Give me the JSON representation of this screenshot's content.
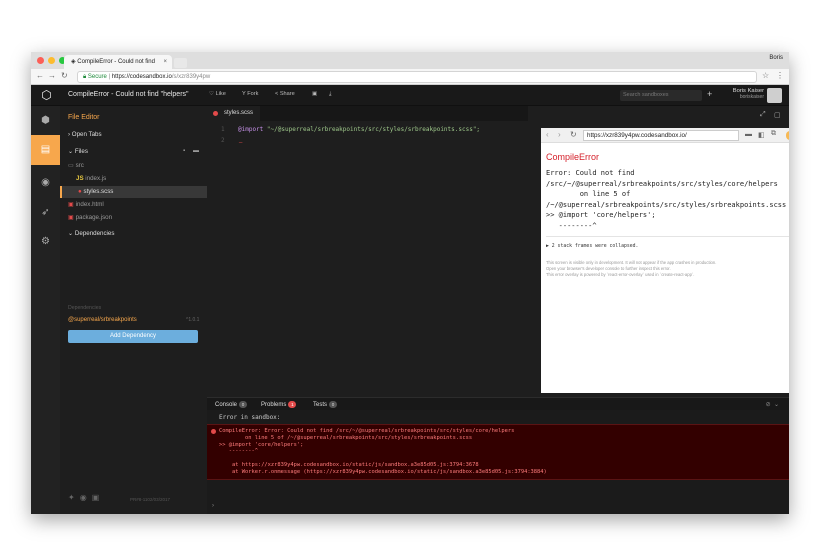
{
  "browser": {
    "tab_title": "CompileError - Could not find",
    "tab_close": "×",
    "profile_name": "Boris",
    "secure_label": "Secure",
    "url_host": "https://codesandbox.io",
    "url_path": "/s/xzr839y4pw"
  },
  "header": {
    "title": "CompileError - Could not find \"helpers\"",
    "like": "Like",
    "fork": "Fork",
    "share": "Share",
    "search_placeholder": "Search sandboxes",
    "user_name": "Boris Kaiser",
    "user_handle": "boriskaiser"
  },
  "explorer": {
    "title": "File Editor",
    "open_tabs": "Open Tabs",
    "files": "Files",
    "items": [
      {
        "name": "src",
        "icon": "folder-icon"
      },
      {
        "name": "index.js",
        "icon": "js-file-icon"
      },
      {
        "name": "styles.scss",
        "icon": "error-dot-icon"
      },
      {
        "name": "index.html",
        "icon": "html-file-icon"
      },
      {
        "name": "package.json",
        "icon": "json-file-icon"
      }
    ],
    "dependencies": "Dependencies",
    "dependencies_sub": "Dependencies",
    "dep_name": "@superreal/srbreakpoints",
    "dep_version": "^1.0.1",
    "add_dependency": "Add Dependency",
    "version_text": "PR#8-1102/03/2017"
  },
  "editor": {
    "tab": "styles.scss",
    "line_numbers": [
      "1",
      "2"
    ],
    "code_keyword": "@import",
    "code_string": "\"~/@superreal/srbreakpoints/src/styles/srbreakpoints.scss\";",
    "error_marker": "_"
  },
  "preview": {
    "url": "https://xzr839y4pw.codesandbox.io/",
    "error_title": "CompileError",
    "close": "×",
    "message": "Error: Could not find\n/src/~/@superreal/srbreakpoints/src/styles/core/helpers\n        on line 5 of\n/~/@superreal/srbreakpoints/src/styles/srbreakpoints.scss\n>> @import 'core/helpers';\n   --------^",
    "collapsed": "▶ 2 stack frames were collapsed.",
    "footer_1": "This screen is visible only in development. It will not appear if the app crashes in production.",
    "footer_2": "Open your browser's developer console to further inspect this error.",
    "footer_3": "This error overlay is powered by `react-error-overlay` used in `create-react-app`."
  },
  "console": {
    "tab_console": "Console",
    "tab_console_count": "0",
    "tab_problems": "Problems",
    "tab_problems_count": "1",
    "tab_tests": "Tests",
    "tab_tests_count": "0",
    "line1": "Error in sandbox:",
    "error_text": "CompileError: Error: Could not find /src/~/@superreal/srbreakpoints/src/styles/core/helpers\n        on line 5 of /~/@superreal/srbreakpoints/src/styles/srbreakpoints.scss\n>> @import 'core/helpers';\n   --------^\n\n    at https://xzr839y4pw.codesandbox.io/static/js/sandbox.a3e85d05.js:3794:3678\n    at Worker.r.onmessage (https://xzr839y4pw.codesandbox.io/static/js/sandbox.a3e85d05.js:3794:3884)",
    "prompt": "›"
  },
  "colors": {
    "accent": "#f7a74c",
    "error": "#e24a4a",
    "link": "#6caedd"
  }
}
